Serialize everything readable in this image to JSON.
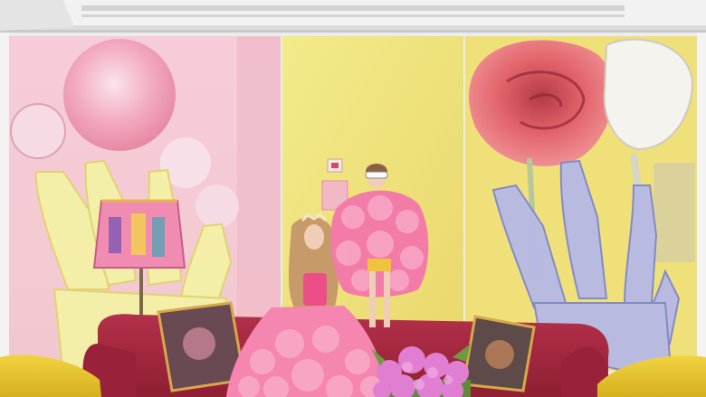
{
  "scene": {
    "palette": {
      "ceiling": "#f1f1f1",
      "molding": "#dedede",
      "wall": "#ececec",
      "panel_pink": "#f3c9d5",
      "panel_yellow": "#efe27c",
      "rose_red": "#d95a5c",
      "sofa_red": "#a8283f",
      "armchair_yellow": "#e9c62b",
      "dress_pink": "#f47fa8",
      "hydrangea": "#e47fd2",
      "lamp_shade": "#ee7fae"
    }
  }
}
